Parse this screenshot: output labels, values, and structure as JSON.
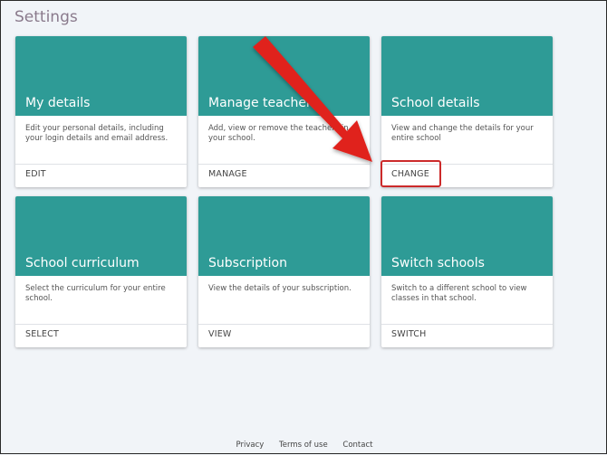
{
  "page": {
    "title": "Settings"
  },
  "cards": [
    {
      "title": "My details",
      "description": "Edit your personal details, including your login details and email address.",
      "action": "EDIT"
    },
    {
      "title": "Manage teachers",
      "description": "Add, view or remove the teachers in your school.",
      "action": "MANAGE"
    },
    {
      "title": "School details",
      "description": "View and change the details for your entire school",
      "action": "CHANGE"
    },
    {
      "title": "School curriculum",
      "description": "Select the curriculum for your entire school.",
      "action": "SELECT"
    },
    {
      "title": "Subscription",
      "description": "View the details of your subscription.",
      "action": "VIEW"
    },
    {
      "title": "Switch schools",
      "description": "Switch to a different school to view classes in that school.",
      "action": "SWITCH"
    }
  ],
  "footer": {
    "privacy": "Privacy",
    "terms": "Terms of use",
    "contact": "Contact"
  },
  "colors": {
    "card_header": "#2e9b96",
    "annotation": "#e0211c",
    "highlight": "#cc2a2a",
    "title": "#8a7a8c"
  }
}
